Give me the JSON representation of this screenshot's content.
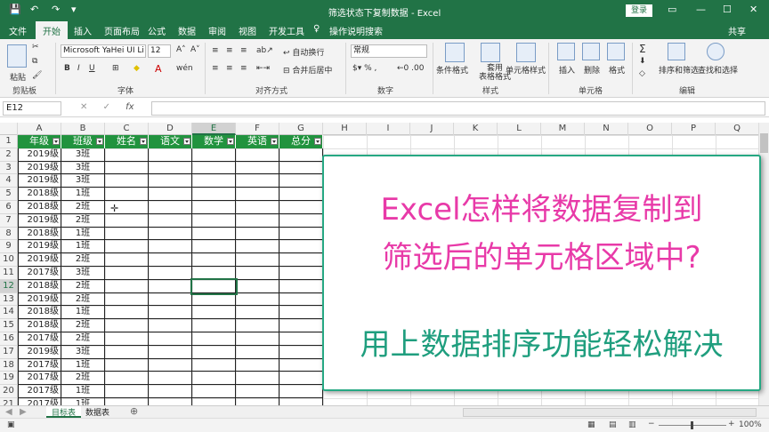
{
  "titlebar": {
    "title": "筛选状态下复制数据 - Excel",
    "login": "登录",
    "quick": [
      "💾",
      "↶",
      "↷",
      "▾"
    ],
    "win": [
      "▭",
      "—",
      "☐",
      "✕"
    ]
  },
  "tabs": [
    "文件",
    "开始",
    "插入",
    "页面布局",
    "公式",
    "数据",
    "审阅",
    "视图",
    "开发工具"
  ],
  "tell_me": "操作说明搜索",
  "share": "共享",
  "ribbon": {
    "paste": "粘贴",
    "font_name": "Microsoft YaHei UI Li",
    "font_size": "12",
    "wrap": "自动换行",
    "merge": "合并后居中",
    "number_format": "常规",
    "cond_format": "条件格式",
    "table_format": "套用\n表格格式",
    "cell_style": "单元格样式",
    "insert": "插入",
    "delete": "删除",
    "format": "格式",
    "sort_filter": "排序和筛选",
    "find_select": "查找和选择",
    "groups": [
      "剪贴板",
      "字体",
      "对齐方式",
      "数字",
      "样式",
      "单元格",
      "编辑"
    ]
  },
  "formula_bar": {
    "name_box": "E12",
    "fx": "fx",
    "cancel": "✕",
    "enter": "✓"
  },
  "columns": [
    "A",
    "B",
    "C",
    "D",
    "E",
    "F",
    "G",
    "H",
    "I",
    "J",
    "K",
    "L",
    "M",
    "N",
    "O",
    "P",
    "Q"
  ],
  "headers": [
    "年级",
    "班级",
    "姓名",
    "语文",
    "数学",
    "英语",
    "总分"
  ],
  "rows": [
    [
      "2019级",
      "3班"
    ],
    [
      "2019级",
      "3班"
    ],
    [
      "2019级",
      "3班"
    ],
    [
      "2018级",
      "1班"
    ],
    [
      "2018级",
      "2班"
    ],
    [
      "2019级",
      "2班"
    ],
    [
      "2018级",
      "1班"
    ],
    [
      "2019级",
      "1班"
    ],
    [
      "2019级",
      "2班"
    ],
    [
      "2017级",
      "3班"
    ],
    [
      "2018级",
      "2班"
    ],
    [
      "2019级",
      "2班"
    ],
    [
      "2018级",
      "1班"
    ],
    [
      "2018级",
      "2班"
    ],
    [
      "2017级",
      "2班"
    ],
    [
      "2019级",
      "3班"
    ],
    [
      "2017级",
      "1班"
    ],
    [
      "2017级",
      "2班"
    ],
    [
      "2017级",
      "1班"
    ],
    [
      "2017级",
      "1班"
    ]
  ],
  "row_numbers": [
    "1",
    "2",
    "3",
    "4",
    "5",
    "6",
    "7",
    "8",
    "9",
    "10",
    "11",
    "12",
    "13",
    "14",
    "15",
    "16",
    "17",
    "18",
    "19",
    "20",
    "21"
  ],
  "overlay": {
    "line1": "Excel怎样将数据复制到",
    "line2": "筛选后的单元格区域中?",
    "line3": "用上数据排序功能轻松解决",
    "color1": "#e83aa8",
    "color2": "#e83aa8",
    "color3": "#1f9e7e"
  },
  "sheets": [
    "目标表",
    "数据表"
  ],
  "status": {
    "zoom": "100%"
  },
  "colors": {
    "brand": "#217346",
    "header_fill": "#21933e"
  }
}
